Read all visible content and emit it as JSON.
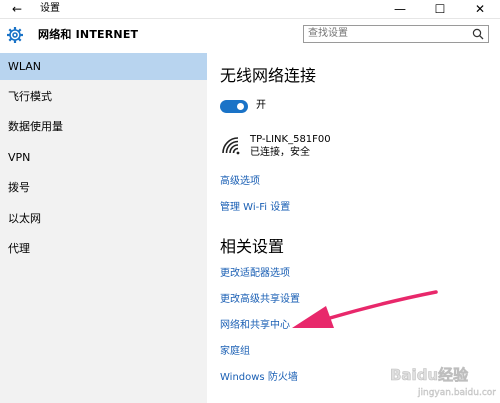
{
  "titlebar": {
    "back_glyph": "←",
    "title": "设置",
    "minimize": "—",
    "maximize": "☐",
    "close": "✕"
  },
  "header": {
    "title": "网络和 INTERNET",
    "search_placeholder": "查找设置"
  },
  "sidebar": {
    "items": [
      {
        "label": "WLAN",
        "active": true
      },
      {
        "label": "飞行模式"
      },
      {
        "label": "数据使用量"
      },
      {
        "label": "VPN"
      },
      {
        "label": "拨号"
      },
      {
        "label": "以太网"
      },
      {
        "label": "代理"
      }
    ]
  },
  "main": {
    "wireless_heading": "无线网络连接",
    "toggle": {
      "state": "on",
      "label": "开"
    },
    "network": {
      "name": "TP-LINK_581F00",
      "status": "已连接，安全"
    },
    "advanced_link": "高级选项",
    "manage_wifi_link": "管理 Wi-Fi 设置",
    "related_heading": "相关设置",
    "related_links": [
      "更改适配器选项",
      "更改高级共享设置",
      "网络和共享中心",
      "家庭组",
      "Windows 防火墙"
    ]
  },
  "colors": {
    "accent": "#1a73c7",
    "link": "#1a5fb4",
    "sidebar_bg": "#f2f2f2",
    "active_bg": "#b8d4ef",
    "annotation_arrow": "#e8286b"
  },
  "watermark": {
    "brand": "Baidu经验",
    "url": "jingyan.baidu.com"
  }
}
